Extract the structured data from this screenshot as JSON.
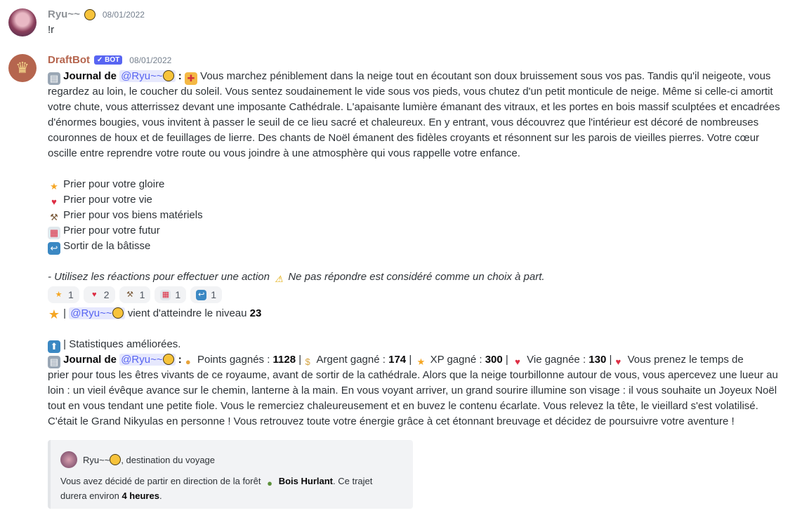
{
  "colors": {
    "mention_bg": "#e6e8fd",
    "mention_text": "#5865f2",
    "bot_badge": "#5865f2",
    "bot_name": "#b5654e",
    "user_name": "#8e9297"
  },
  "msg1": {
    "author": "Ryu~~",
    "date": "08/01/2022",
    "text": "!r"
  },
  "msg2": {
    "author": "DraftBot",
    "badge": "✓ BOT",
    "date": "08/01/2022",
    "journal_label": "Journal de",
    "mention": "@Ryu~~",
    "colon": ":",
    "story": [
      "Vous marchez péniblement dans la neige tout en écoutant son doux bruissement sous vos pas. Tandis qu'il neigeote, vous",
      "regardez au loin, le coucher du soleil. Vous sentez soudainement le vide sous vos pieds, vous chutez d'un petit monticule de neige. Même si celle-ci amortit",
      "votre chute, vous atterrissez devant une imposante Cathédrale. L'apaisante lumière émanant des vitraux, et les portes en bois massif sculptées et encadrées",
      "d'énormes bougies, vous invitent à passer le seuil de ce lieu sacré et chaleureux. En y entrant, vous découvrez que l'intérieur est décoré de nombreuses",
      "couronnes de houx et de feuillages de lierre. Des chants de Noël émanent des fidèles croyants et résonnent sur les parois de vieilles pierres. Votre cœur",
      "oscille entre reprendre votre route ou vous joindre à une atmosphère qui vous rappelle votre enfance."
    ],
    "choices": [
      {
        "icon": "star-icon",
        "label": "Prier pour votre gloire"
      },
      {
        "icon": "gift-heart-icon",
        "label": "Prier pour votre vie"
      },
      {
        "icon": "hammer-pick-icon",
        "label": "Prier pour vos biens matériels"
      },
      {
        "icon": "calendar-icon",
        "label": "Prier pour votre futur"
      },
      {
        "icon": "return-arrow-icon",
        "label": "Sortir de la bâtisse"
      }
    ],
    "hint_a": "- Utilisez les réactions pour effectuer une action",
    "hint_b": "Ne pas répondre est considéré comme un choix à part.",
    "reactions": [
      {
        "icon": "star-icon",
        "count": "1"
      },
      {
        "icon": "gift-heart-icon",
        "count": "2"
      },
      {
        "icon": "hammer-pick-icon",
        "count": "1"
      },
      {
        "icon": "calendar-icon",
        "count": "1"
      },
      {
        "icon": "return-arrow-icon",
        "count": "1"
      }
    ],
    "level_sep": "|",
    "level_text": "vient d'atteindre le niveau",
    "level": "23",
    "stats_text": "| Statistiques améliorées.",
    "points_label": "Points gagnés :",
    "points": "1128",
    "money_label": "Argent gagné :",
    "money": "174",
    "xp_label": "XP gagné :",
    "xp": "300",
    "life_label": "Vie gagnée :",
    "life": "130",
    "sep": "|",
    "story2_first": "Vous prenez le temps de",
    "story2": [
      "prier pour tous les êtres vivants de ce royaume, avant de sortir de la cathédrale. Alors que la neige tourbillonne autour de vous, vous apercevez une lueur au",
      "loin : un vieil évêque avance sur le chemin, lanterne à la main. En vous voyant arriver, un grand sourire illumine son visage : il vous souhaite un Joyeux Noël",
      "tout en vous tendant une petite fiole. Vous le remerciez chaleureusement et en buvez le contenu écarlate. Vous relevez la tête, le vieillard s'est volatilisé.",
      "C'était le Grand Nikyulas en personne ! Vous retrouvez toute votre énergie grâce à cet étonnant breuvage et décidez de poursuivre votre aventure !"
    ],
    "embed": {
      "author": "Ryu~~",
      "author_suffix": ", destination du voyage",
      "desc_a": "Vous avez décidé de partir en direction de la forêt",
      "place": "Bois Hurlant",
      "desc_b": ". Ce trajet",
      "desc_c": "durera environ",
      "duration": "4 heures",
      "desc_d": "."
    }
  }
}
